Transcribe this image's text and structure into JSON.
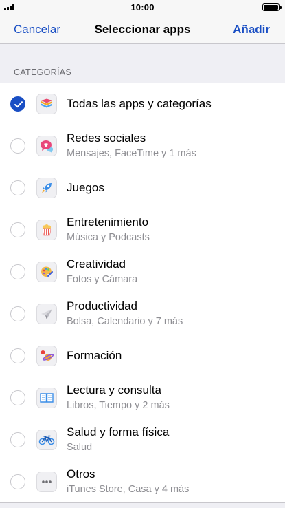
{
  "status_bar": {
    "time": "10:00"
  },
  "nav": {
    "cancel_label": "Cancelar",
    "title": "Seleccionar apps",
    "add_label": "Añadir"
  },
  "section": {
    "header": "CATEGORÍAS"
  },
  "accent_color": "#1a4fc4",
  "items": [
    {
      "title": "Todas las apps y categorías",
      "subtitle": "",
      "icon": "stack-layers-icon",
      "checked": true
    },
    {
      "title": "Redes sociales",
      "subtitle": "Mensajes, FaceTime y 1 más",
      "icon": "chat-heart-icon",
      "checked": false
    },
    {
      "title": "Juegos",
      "subtitle": "",
      "icon": "rocket-icon",
      "checked": false
    },
    {
      "title": "Entretenimiento",
      "subtitle": "Música y Podcasts",
      "icon": "popcorn-icon",
      "checked": false
    },
    {
      "title": "Creatividad",
      "subtitle": "Fotos y Cámara",
      "icon": "palette-icon",
      "checked": false
    },
    {
      "title": "Productividad",
      "subtitle": "Bolsa, Calendario y 7 más",
      "icon": "paper-plane-icon",
      "checked": false
    },
    {
      "title": "Formación",
      "subtitle": "",
      "icon": "planet-icon",
      "checked": false
    },
    {
      "title": "Lectura y consulta",
      "subtitle": "Libros, Tiempo y 2 más",
      "icon": "open-book-icon",
      "checked": false
    },
    {
      "title": "Salud y forma física",
      "subtitle": "Salud",
      "icon": "bicycle-icon",
      "checked": false
    },
    {
      "title": "Otros",
      "subtitle": "iTunes Store, Casa y 4 más",
      "icon": "ellipsis-icon",
      "checked": false
    }
  ]
}
